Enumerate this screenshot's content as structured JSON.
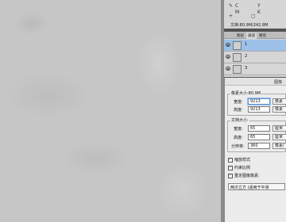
{
  "top_panel": {
    "icons": [
      "CMYK",
      "C",
      "M",
      "Y",
      "K"
    ],
    "doc_info": "文档:80.9M/242.8M"
  },
  "layers": {
    "tabs": [
      "图层",
      "通道",
      "路径"
    ],
    "items": [
      {
        "name": "1",
        "active": true
      },
      {
        "name": "2",
        "active": false
      },
      {
        "name": "3",
        "active": false
      }
    ]
  },
  "dialog": {
    "title": "图像",
    "pixel_group": {
      "title": "像素大小:80.9M",
      "width_label": "宽度:",
      "width_value": "9213",
      "width_unit": "像素",
      "height_label": "高度:",
      "height_value": "9213",
      "height_unit": "像素"
    },
    "doc_group": {
      "title": "文档大小:",
      "width_label": "宽度:",
      "width_value": "65",
      "width_unit": "厘米",
      "height_label": "高度:",
      "height_value": "65",
      "height_unit": "厘米",
      "res_label": "分辨率:",
      "res_value": "360",
      "res_unit": "像素/"
    },
    "checkboxes": [
      "缩放样式",
      "约束比例",
      "重定图像像素:"
    ],
    "resample": "两次立方 (适用于平滑"
  }
}
